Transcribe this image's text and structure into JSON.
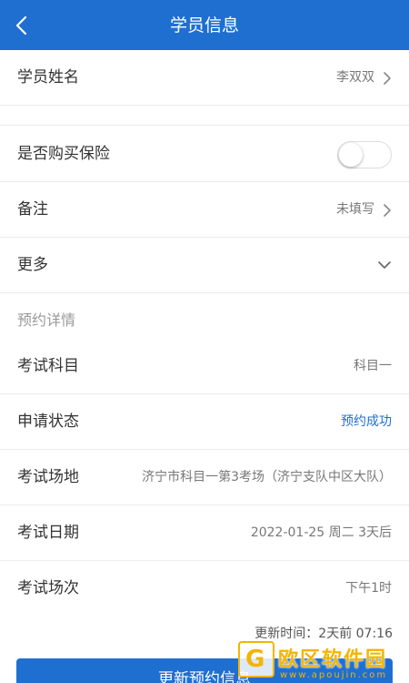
{
  "header": {
    "title": "学员信息"
  },
  "rows": {
    "name": {
      "label": "学员姓名",
      "value": "李双双"
    },
    "insurance": {
      "label": "是否购买保险",
      "toggle_on": false
    },
    "remark": {
      "label": "备注",
      "value": "未填写"
    },
    "more": {
      "label": "更多"
    }
  },
  "booking": {
    "section_title": "预约详情",
    "subject": {
      "label": "考试科目",
      "value": "科目一"
    },
    "status": {
      "label": "申请状态",
      "value": "预约成功",
      "color": "#1f6fd1"
    },
    "venue": {
      "label": "考试场地",
      "value": "济宁市科目一第3考场（济宁支队中区大队）"
    },
    "date": {
      "label": "考试日期",
      "value": "2022-01-25 周二 3天后"
    },
    "session": {
      "label": "考试场次",
      "value": "下午1时"
    }
  },
  "footer": {
    "update_time": "更新时间：2天前 07:16",
    "update_button": "更新预约信息"
  },
  "watermark": {
    "logo_letter": "G",
    "text": "欧区软件园",
    "url": "www.apoujin.com"
  },
  "colors": {
    "brand": "#1f6fd1",
    "watermark": "#f4b400"
  }
}
